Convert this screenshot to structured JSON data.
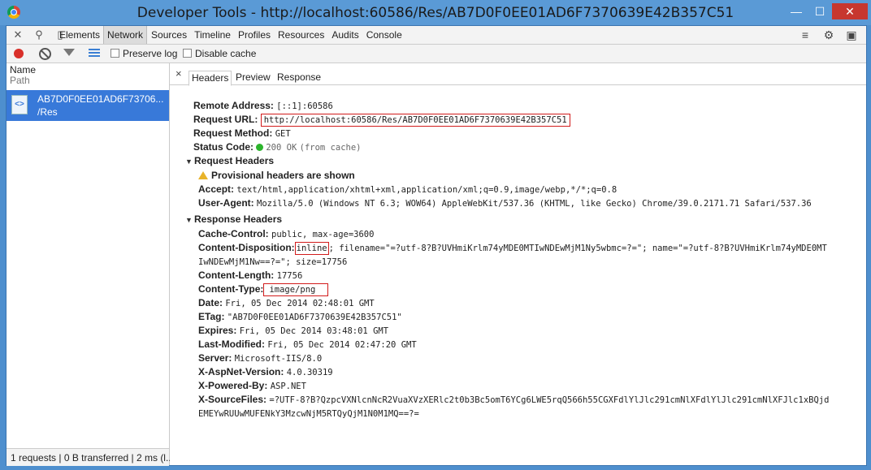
{
  "window": {
    "title": "Developer Tools - http://localhost:60586/Res/AB7D0F0EE01AD6F7370639E42B357C51"
  },
  "toolbar": {
    "tabs": [
      "Elements",
      "Network",
      "Sources",
      "Timeline",
      "Profiles",
      "Resources",
      "Audits",
      "Console"
    ],
    "active_tab": "Network"
  },
  "subbar": {
    "preserve_log": "Preserve log",
    "disable_cache": "Disable cache"
  },
  "left_panel": {
    "col_name": "Name",
    "col_path": "Path",
    "request": {
      "name": "AB7D0F0EE01AD6F73706...",
      "path": "/Res"
    },
    "status": "1 requests | 0 B transferred | 2 ms (l..."
  },
  "detail": {
    "close": "×",
    "tabs": [
      "Headers",
      "Preview",
      "Response"
    ],
    "active_tab": "Headers",
    "general": [
      {
        "key": "Remote Address:",
        "value": "[::1]:60586"
      },
      {
        "key": "Request URL:",
        "value": "http://localhost:60586/Res/AB7D0F0EE01AD6F7370639E42B357C51"
      },
      {
        "key": "Request Method:",
        "value": "GET"
      },
      {
        "key": "Status Code:",
        "value": "200 OK",
        "note": "(from cache)"
      }
    ],
    "request_headers": {
      "title": "Request Headers",
      "provisional": "Provisional headers are shown",
      "items": [
        {
          "key": "Accept:",
          "value": "text/html,application/xhtml+xml,application/xml;q=0.9,image/webp,*/*;q=0.8"
        },
        {
          "key": "User-Agent:",
          "value": "Mozilla/5.0 (Windows NT 6.3; WOW64) AppleWebKit/537.36 (KHTML, like Gecko) Chrome/39.0.2171.71 Safari/537.36"
        }
      ]
    },
    "response_headers": {
      "title": "Response Headers",
      "cache_control": {
        "key": "Cache-Control:",
        "value": "public, max-age=3600"
      },
      "content_disposition": {
        "key": "Content-Disposition:",
        "inline": "inline",
        "rest1": "; filename=\"=?utf-8?B?UVHmiKrlm74yMDE0MTIwNDEwMjM1Ny5wbmc=?=\"; name=\"=?utf-8?B?UVHmiKrlm74yMDE0MT",
        "rest2": "IwNDEwMjM1Nw==?=\"; size=17756"
      },
      "content_length": {
        "key": "Content-Length:",
        "value": "17756"
      },
      "content_type": {
        "key": "Content-Type:",
        "value": "image/png"
      },
      "items": [
        {
          "key": "Date:",
          "value": "Fri, 05 Dec 2014 02:48:01 GMT"
        },
        {
          "key": "ETag:",
          "value": "\"AB7D0F0EE01AD6F7370639E42B357C51\""
        },
        {
          "key": "Expires:",
          "value": "Fri, 05 Dec 2014 03:48:01 GMT"
        },
        {
          "key": "Last-Modified:",
          "value": "Fri, 05 Dec 2014 02:47:20 GMT"
        },
        {
          "key": "Server:",
          "value": "Microsoft-IIS/8.0"
        },
        {
          "key": "X-AspNet-Version:",
          "value": "4.0.30319"
        },
        {
          "key": "X-Powered-By:",
          "value": "ASP.NET"
        }
      ],
      "sourcefiles": {
        "key": "X-SourceFiles:",
        "line1": "=?UTF-8?B?QzpcVXNlcnNcR2VuaXVzXERlc2t0b3Bc5omT6YCg6LWE5rqQ566h55CGXFdlYlJlc291cmNlXFdlYlJlc291cmNlXFJlc1xBQjd",
        "line2": "EMEYwRUUwMUFENkY3MzcwNjM5RTQyQjM1N0M1MQ==?="
      }
    }
  }
}
